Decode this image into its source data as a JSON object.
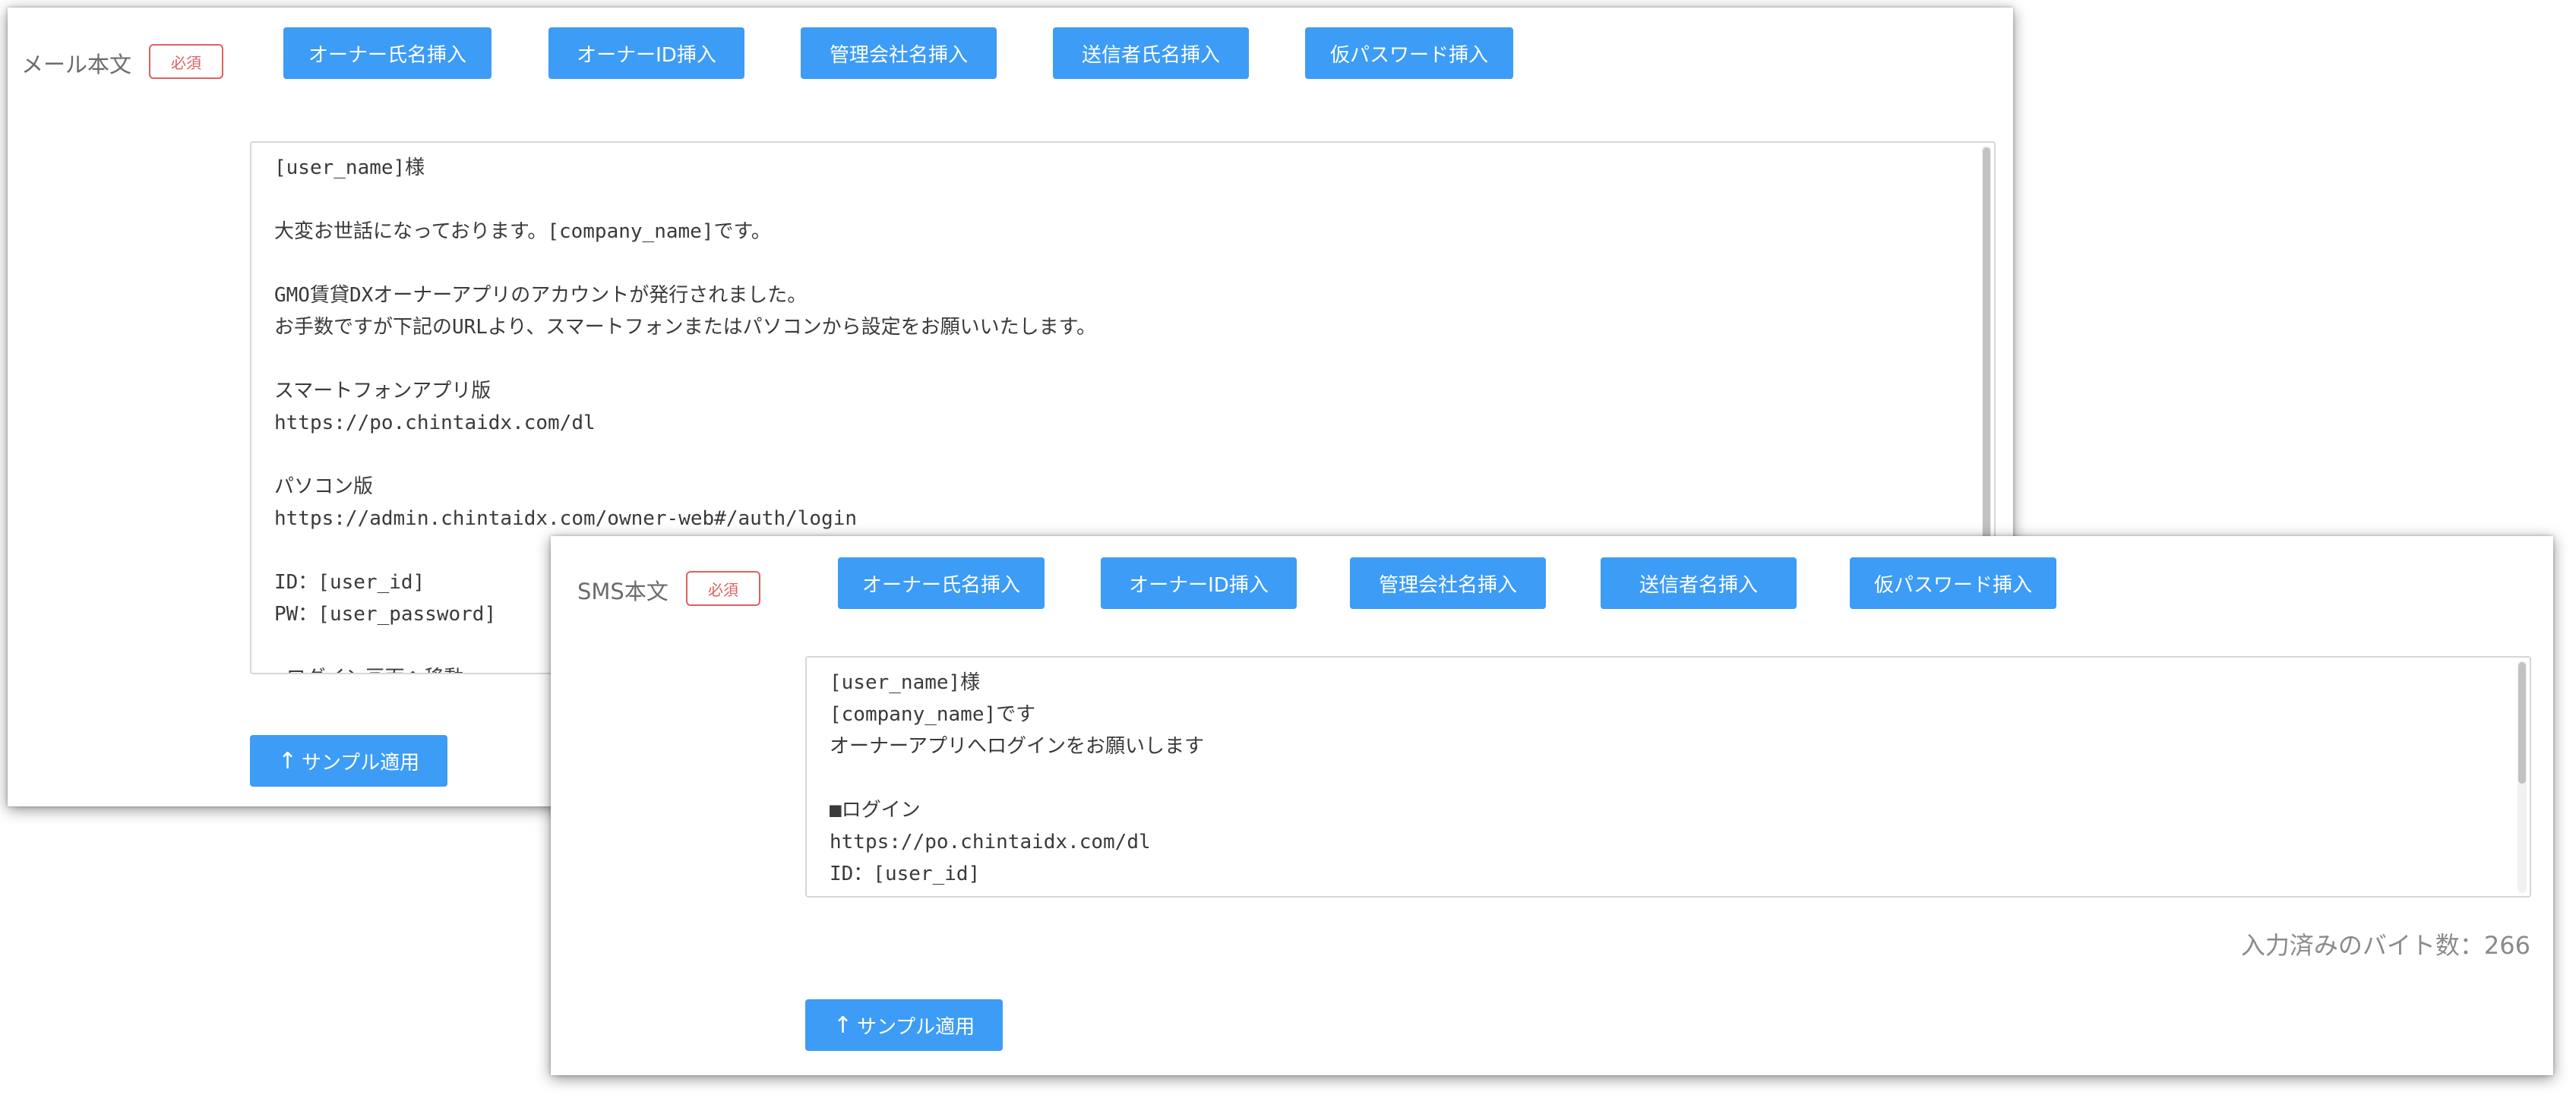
{
  "mail": {
    "label": "メール本文",
    "required": "必須",
    "buttons": [
      "オーナー氏名挿入",
      "オーナーID挿入",
      "管理会社名挿入",
      "送信者氏名挿入",
      "仮パスワード挿入"
    ],
    "body": "[user_name]様\n\n大変お世話になっております。[company_name]です。\n\nGMO賃貸DXオーナーアプリのアカウントが発行されました。\nお手数ですが下記のURLより、スマートフォンまたはパソコンから設定をお願いいたします。\n\nスマートフォンアプリ版\nhttps://po.chintaidx.com/dl\n\nパソコン版\nhttps://admin.chintaidx.com/owner-web#/auth/login\n\nID：[user_id]\nPW：[user_password]\n\n▼ログイン画面へ移動",
    "sample_button": "サンプル適用"
  },
  "sms": {
    "label": "SMS本文",
    "required": "必須",
    "buttons": [
      "オーナー氏名挿入",
      "オーナーID挿入",
      "管理会社名挿入",
      "送信者名挿入",
      "仮パスワード挿入"
    ],
    "body": "[user_name]様\n[company_name]です\nオーナーアプリへログインをお願いします\n\n■ログイン\nhttps://po.chintaidx.com/dl\nID：[user_id]\nPW：[user_password]",
    "byte_count_label": "入力済みのバイト数：266",
    "sample_button": "サンプル適用"
  },
  "colors": {
    "button_blue": "#3d9cf5",
    "required_red": "#e06060"
  }
}
